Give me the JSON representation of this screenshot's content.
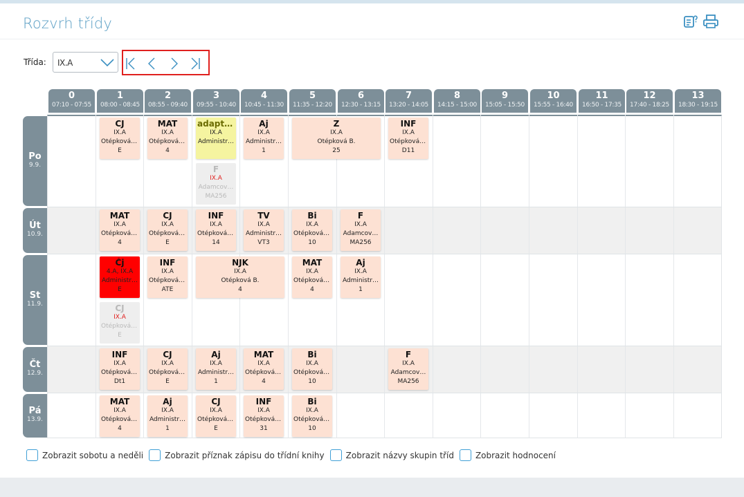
{
  "page": {
    "title": "Rozvrh třídy"
  },
  "toolbar": {
    "help_icon": "help-icon",
    "print_icon": "print-icon"
  },
  "filter": {
    "label": "Třída:",
    "selected": "IX.A"
  },
  "nav": {
    "first": "first-page-icon",
    "prev": "prev-icon",
    "next": "next-icon",
    "last": "last-page-icon"
  },
  "hours": [
    {
      "num": "0",
      "time": "07:10 - 07:55"
    },
    {
      "num": "1",
      "time": "08:00 - 08:45"
    },
    {
      "num": "2",
      "time": "08:55 - 09:40"
    },
    {
      "num": "3",
      "time": "09:55 - 10:40"
    },
    {
      "num": "4",
      "time": "10:45 - 11:30"
    },
    {
      "num": "5",
      "time": "11:35 - 12:20"
    },
    {
      "num": "6",
      "time": "12:30 - 13:15"
    },
    {
      "num": "7",
      "time": "13:20 - 14:05"
    },
    {
      "num": "8",
      "time": "14:15 - 15:00"
    },
    {
      "num": "9",
      "time": "15:05 - 15:50"
    },
    {
      "num": "10",
      "time": "15:55 - 16:40"
    },
    {
      "num": "11",
      "time": "16:50 - 17:35"
    },
    {
      "num": "12",
      "time": "17:40 - 18:25"
    },
    {
      "num": "13",
      "time": "18:30 - 19:15"
    }
  ],
  "days": [
    {
      "name": "Po",
      "date": "9.9."
    },
    {
      "name": "Út",
      "date": "10.9."
    },
    {
      "name": "St",
      "date": "11.9."
    },
    {
      "name": "Čt",
      "date": "12.9."
    },
    {
      "name": "Pá",
      "date": "13.9."
    }
  ],
  "lessons": [
    {
      "day": 0,
      "col": 1,
      "span": 1,
      "sub": 0,
      "style": "normal",
      "subject": "CJ",
      "cls": "IX.A",
      "teacher": "Otépková B.",
      "room": "E"
    },
    {
      "day": 0,
      "col": 2,
      "span": 1,
      "sub": 0,
      "style": "normal",
      "subject": "MAT",
      "cls": "IX.A",
      "teacher": "Otépková B.",
      "room": "4"
    },
    {
      "day": 0,
      "col": 3,
      "span": 1,
      "sub": 0,
      "style": "yellow",
      "subject": "adaptač…",
      "cls": "IX.A",
      "teacher": "Administr…",
      "room": ""
    },
    {
      "day": 0,
      "col": 3,
      "span": 1,
      "sub": 1,
      "style": "gray",
      "subject": "F",
      "cls": "IX.A",
      "teacher": "Adamcov…",
      "room": "MA256"
    },
    {
      "day": 0,
      "col": 4,
      "span": 1,
      "sub": 0,
      "style": "normal",
      "subject": "Aj",
      "cls": "IX.A",
      "teacher": "Administr…",
      "room": "1"
    },
    {
      "day": 0,
      "col": 5,
      "span": 2,
      "sub": 0,
      "style": "normal",
      "subject": "Z",
      "cls": "IX.A",
      "teacher": "Otépková B.",
      "room": "25"
    },
    {
      "day": 0,
      "col": 7,
      "span": 1,
      "sub": 0,
      "style": "normal",
      "subject": "INF",
      "cls": "IX.A",
      "teacher": "Otépková B.",
      "room": "D11"
    },
    {
      "day": 1,
      "col": 1,
      "span": 1,
      "sub": 0,
      "style": "normal",
      "subject": "MAT",
      "cls": "IX.A",
      "teacher": "Otépková B.",
      "room": "4"
    },
    {
      "day": 1,
      "col": 2,
      "span": 1,
      "sub": 0,
      "style": "normal",
      "subject": "CJ",
      "cls": "IX.A",
      "teacher": "Otépková B.",
      "room": "E"
    },
    {
      "day": 1,
      "col": 3,
      "span": 1,
      "sub": 0,
      "style": "normal",
      "subject": "INF",
      "cls": "IX.A",
      "teacher": "Otépková B.",
      "room": "14"
    },
    {
      "day": 1,
      "col": 4,
      "span": 1,
      "sub": 0,
      "style": "normal",
      "subject": "TV",
      "cls": "IX.A",
      "teacher": "Administr…",
      "room": "VT3"
    },
    {
      "day": 1,
      "col": 5,
      "span": 1,
      "sub": 0,
      "style": "normal",
      "subject": "Bi",
      "cls": "IX.A",
      "teacher": "Otépková B.",
      "room": "10"
    },
    {
      "day": 1,
      "col": 6,
      "span": 1,
      "sub": 0,
      "style": "normal",
      "subject": "F",
      "cls": "IX.A",
      "teacher": "Adamcov…",
      "room": "MA256"
    },
    {
      "day": 2,
      "col": 1,
      "span": 1,
      "sub": 0,
      "style": "red",
      "subject": "Čj",
      "cls": "4.A, IX.A",
      "teacher": "Administr…",
      "room": "E"
    },
    {
      "day": 2,
      "col": 1,
      "span": 1,
      "sub": 1,
      "style": "gray",
      "subject": "CJ",
      "cls": "IX.A",
      "teacher": "Otépková B.",
      "room": "E"
    },
    {
      "day": 2,
      "col": 2,
      "span": 1,
      "sub": 0,
      "style": "normal",
      "subject": "INF",
      "cls": "IX.A",
      "teacher": "Otépková B.",
      "room": "ATE"
    },
    {
      "day": 2,
      "col": 3,
      "span": 2,
      "sub": 0,
      "style": "normal",
      "subject": "NJK",
      "cls": "IX.A",
      "teacher": "Otépková B.",
      "room": "4"
    },
    {
      "day": 2,
      "col": 5,
      "span": 1,
      "sub": 0,
      "style": "normal",
      "subject": "MAT",
      "cls": "IX.A",
      "teacher": "Otépková B.",
      "room": "4"
    },
    {
      "day": 2,
      "col": 6,
      "span": 1,
      "sub": 0,
      "style": "normal",
      "subject": "Aj",
      "cls": "IX.A",
      "teacher": "Administr…",
      "room": "1"
    },
    {
      "day": 3,
      "col": 1,
      "span": 1,
      "sub": 0,
      "style": "normal",
      "subject": "INF",
      "cls": "IX.A",
      "teacher": "Otépková B.",
      "room": "Dt1"
    },
    {
      "day": 3,
      "col": 2,
      "span": 1,
      "sub": 0,
      "style": "normal",
      "subject": "CJ",
      "cls": "IX.A",
      "teacher": "Otépková B.",
      "room": "E"
    },
    {
      "day": 3,
      "col": 3,
      "span": 1,
      "sub": 0,
      "style": "normal",
      "subject": "Aj",
      "cls": "IX.A",
      "teacher": "Administr…",
      "room": "1"
    },
    {
      "day": 3,
      "col": 4,
      "span": 1,
      "sub": 0,
      "style": "normal",
      "subject": "MAT",
      "cls": "IX.A",
      "teacher": "Otépková B.",
      "room": "4"
    },
    {
      "day": 3,
      "col": 5,
      "span": 1,
      "sub": 0,
      "style": "normal",
      "subject": "Bi",
      "cls": "IX.A",
      "teacher": "Otépková B.",
      "room": "10"
    },
    {
      "day": 3,
      "col": 7,
      "span": 1,
      "sub": 0,
      "style": "normal",
      "subject": "F",
      "cls": "IX.A",
      "teacher": "Adamcov…",
      "room": "MA256"
    },
    {
      "day": 4,
      "col": 1,
      "span": 1,
      "sub": 0,
      "style": "normal",
      "subject": "MAT",
      "cls": "IX.A",
      "teacher": "Otépková B.",
      "room": "4"
    },
    {
      "day": 4,
      "col": 2,
      "span": 1,
      "sub": 0,
      "style": "normal",
      "subject": "Aj",
      "cls": "IX.A",
      "teacher": "Administr…",
      "room": "1"
    },
    {
      "day": 4,
      "col": 3,
      "span": 1,
      "sub": 0,
      "style": "normal",
      "subject": "CJ",
      "cls": "IX.A",
      "teacher": "Otépková B.",
      "room": "E"
    },
    {
      "day": 4,
      "col": 4,
      "span": 1,
      "sub": 0,
      "style": "normal",
      "subject": "INF",
      "cls": "IX.A",
      "teacher": "Otépková B.",
      "room": "31"
    },
    {
      "day": 4,
      "col": 5,
      "span": 1,
      "sub": 0,
      "style": "normal",
      "subject": "Bi",
      "cls": "IX.A",
      "teacher": "Otépková B.",
      "room": "10"
    }
  ],
  "options": [
    {
      "label": "Zobrazit sobotu a neděli",
      "checked": false
    },
    {
      "label": "Zobrazit příznak zápisu do třídní knihy",
      "checked": false
    },
    {
      "label": "Zobrazit názvy skupin tříd",
      "checked": false
    },
    {
      "label": "Zobrazit hodnocení",
      "checked": false
    }
  ]
}
